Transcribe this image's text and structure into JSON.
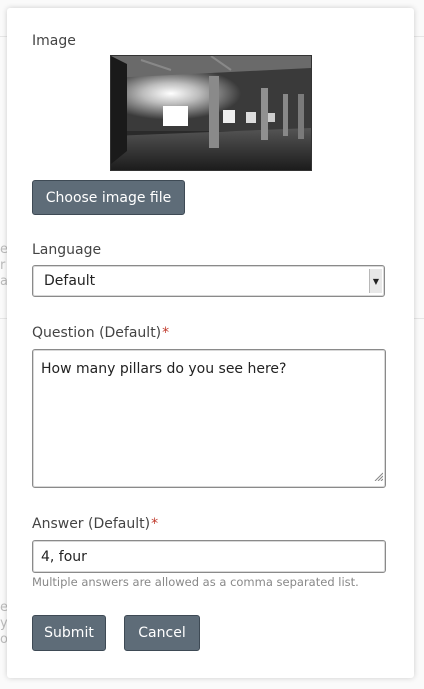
{
  "form": {
    "image_label": "Image",
    "choose_file_label": "Choose image file",
    "language_label": "Language",
    "language_value": "Default",
    "question_label": "Question (Default)",
    "question_value": "How many pillars do you see here?",
    "answer_label": "Answer (Default)",
    "answer_value": "4, four",
    "answer_hint": "Multiple answers are allowed as a comma separated list.",
    "required_mark": "*",
    "submit_label": "Submit",
    "cancel_label": "Cancel"
  },
  "icons": {
    "select_arrow": "chevron-down-icon",
    "resize": "resize-grip-icon"
  },
  "colors": {
    "button_bg": "#5e6c78",
    "required": "#c0392b"
  }
}
